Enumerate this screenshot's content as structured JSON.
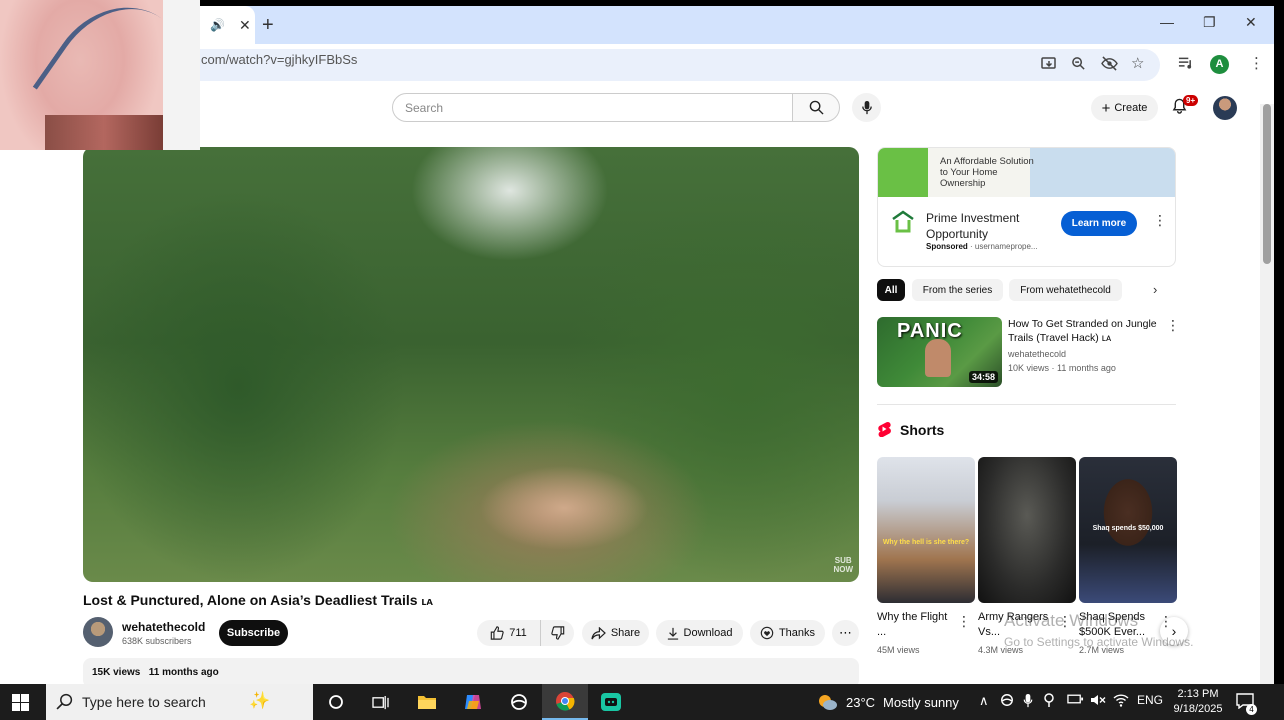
{
  "browser": {
    "tab_close": "✕",
    "new_tab": "+",
    "url": "com/watch?v=gjhkyIFBbSs",
    "window": {
      "minimize": "—",
      "restore": "❐",
      "close": "✕"
    },
    "profile_initial": "A"
  },
  "youtube": {
    "search_placeholder": "Search",
    "create_label": "Create",
    "notif_count": "9+"
  },
  "video": {
    "title": "Lost & Punctured, Alone on Asia’s Deadliest Trails",
    "title_tag": "ʟᴀ",
    "channel": "wehatethecold",
    "subscribers": "638K subscribers",
    "subscribe_label": "Subscribe",
    "likes": "711",
    "share_label": "Share",
    "download_label": "Download",
    "thanks_label": "Thanks",
    "views": "15K views",
    "age": "11 months ago",
    "watermark_line1": "SUB",
    "watermark_line2": "NOW"
  },
  "ad": {
    "banner_text": "An Affordable Solution to Your Home Ownership",
    "title": "Prime Investment Opportunity",
    "sponsored": "Sponsored",
    "domain": "usernameprope...",
    "cta": "Learn more"
  },
  "chips": [
    "All",
    "From the series",
    "From wehatethecold"
  ],
  "related": {
    "thumb_text": "PANIC",
    "duration": "34:58",
    "title": "How To Get Stranded on Jungle Trails (Travel Hack) ʟᴀ",
    "channel": "wehatethecold",
    "meta": "10K views · 11 months ago"
  },
  "shorts": {
    "heading": "Shorts",
    "items": [
      {
        "title": "Why the Flight ...",
        "views": "45M views",
        "caption": "Why the hell is she there?"
      },
      {
        "title": "Army Rangers Vs...",
        "views": "4.3M views",
        "caption": ""
      },
      {
        "title": "Shaq Spends $500K Ever...",
        "views": "2.7M views",
        "caption": "Shaq spends $50,000"
      }
    ]
  },
  "activate": {
    "line1": "Activate Windows",
    "line2": "Go to Settings to activate Windows."
  },
  "taskbar": {
    "search_placeholder": "Type here to search",
    "weather_temp": "23°C",
    "weather_text": "Mostly sunny",
    "lang": "ENG",
    "time": "2:13 PM",
    "date": "9/18/2025",
    "notif_count": "4"
  }
}
